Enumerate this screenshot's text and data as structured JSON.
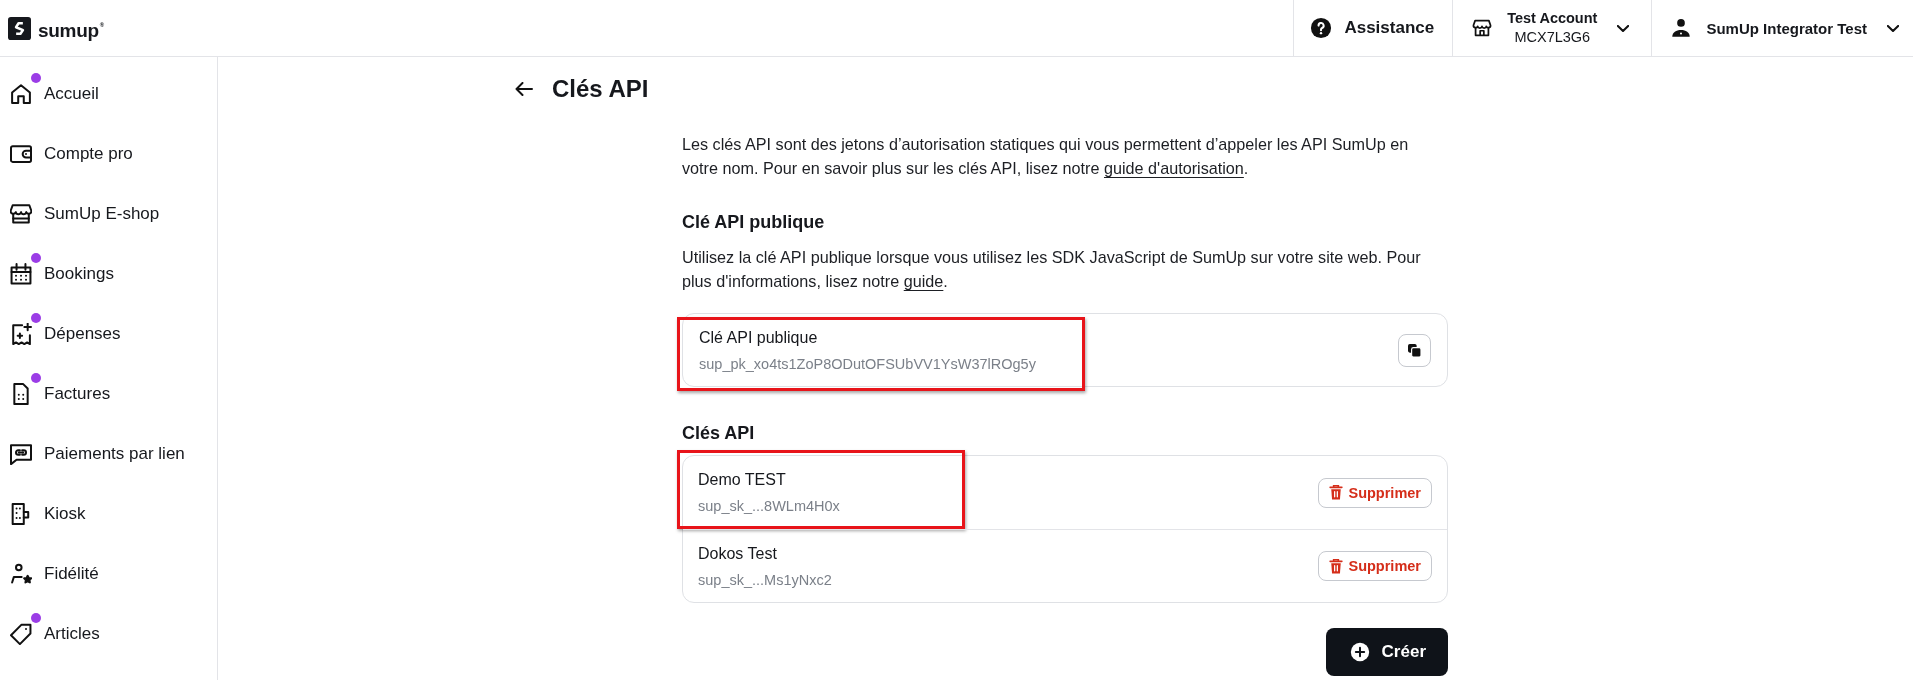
{
  "header": {
    "logo": "sumup$^{®}$",
    "help": {
      "label": "Assistance"
    },
    "account": {
      "name": "Test Account",
      "code": "MCX7L3G6"
    },
    "user": {
      "name": "SumUp Integrator Test"
    }
  },
  "sidebar": {
    "items": [
      {
        "label": "Accueil",
        "dot": true
      },
      {
        "label": "Compte pro",
        "dot": false
      },
      {
        "label": "SumUp E-shop",
        "dot": false
      },
      {
        "label": "Bookings",
        "dot": true
      },
      {
        "label": "Dépenses",
        "dot": true
      },
      {
        "label": "Factures",
        "dot": true
      },
      {
        "label": "Paiements par lien",
        "dot": false
      },
      {
        "label": "Kiosk",
        "dot": false
      },
      {
        "label": "Fidélité",
        "dot": false
      },
      {
        "label": "Articles",
        "dot": true
      }
    ]
  },
  "page": {
    "title": "Clés API",
    "intro": {
      "text": "Les clés API sont des jetons d’autorisation statiques qui vous permettent d’appeler les API SumUp en votre nom. Pour en savoir plus sur les clés API, lisez notre ",
      "link": "guide d'autorisation",
      "after": "."
    },
    "public_section": {
      "heading": "Clé API publique",
      "text": "Utilisez la clé API publique lorsque vous utilisez les SDK JavaScript de SumUp sur votre site web. Pour plus d'informations, lisez notre ",
      "link": "guide",
      "after": ".",
      "key": {
        "label": "Clé API publique",
        "value": "sup_pk_xo4ts1ZoP8ODutOFSUbVV1YsW37lROg5y",
        "highlighted": true
      }
    },
    "keys_section": {
      "heading": "Clés API",
      "keys": [
        {
          "name": "Demo TEST",
          "key": "sup_sk_...8WLm4H0x",
          "delete_label": "Supprimer",
          "highlighted": true
        },
        {
          "name": "Dokos Test",
          "key": "sup_sk_...Ms1yNxc2",
          "delete_label": "Supprimer",
          "highlighted": false
        }
      ]
    },
    "create_button": {
      "label": "Créer"
    }
  }
}
